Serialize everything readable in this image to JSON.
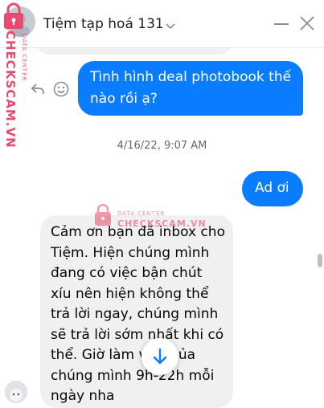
{
  "header": {
    "title": "Tiệm tạp hoá 131",
    "avatar_icon": "avatar",
    "dropdown_icon": "chevron-down-icon",
    "minimize_icon": "minimize-icon",
    "close_icon": "close-icon"
  },
  "watermark": {
    "side_text": "CHECKSCAM.VN",
    "side_small": "DATA CENTER",
    "center_small": "DATA CENTER",
    "center_text": "CHECKSCAM.VN",
    "color": "#e94a6d"
  },
  "messages": [
    {
      "direction": "outgoing",
      "text": "Tình hình deal photobook thế nào rồi ạ?"
    },
    {
      "direction": "outgoing",
      "text": "Ad ơi"
    },
    {
      "direction": "incoming",
      "text": "Cảm ơn bạn đã inbox cho Tiệm. Hiện chúng mình đang có việc bận chút xíu nên hiện không thể trả lời ngay, chúng mình sẽ trả lời sớm nhất khi có thể. Giờ làm việc của chúng mình 9h-22h mỗi ngày nha"
    }
  ],
  "message_actions": {
    "reply_icon": "reply-icon",
    "react_icon": "smiley-icon"
  },
  "timestamp": "4/16/22, 9:07 AM",
  "scroll_button_icon": "arrow-down-icon",
  "colors": {
    "outgoing_bubble": "#0a7cff",
    "incoming_bubble": "#f0f0f0",
    "accent": "#0a7cff"
  }
}
